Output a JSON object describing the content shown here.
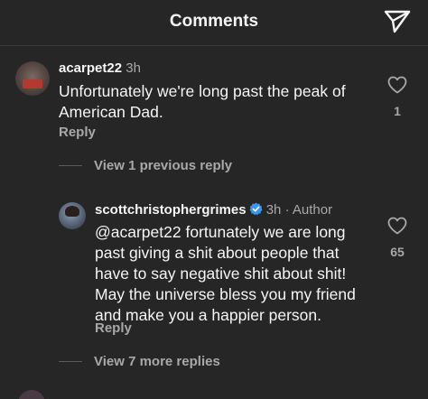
{
  "header": {
    "title": "Comments",
    "share_icon": "paper-plane-icon"
  },
  "comment": {
    "username": "acarpet22",
    "time": "3h",
    "text_line1": "Unfortunately we're long past the peak of",
    "text_line2": "American Dad.",
    "reply_label": "Reply",
    "like_count": "1",
    "view_previous": "View 1 previous reply"
  },
  "reply": {
    "username": "scottchristophergrimes",
    "time": "3h",
    "separator": "·",
    "author_label": "Author",
    "text_lines": [
      "@acarpet22  fortunately we are long",
      "past giving a shit about people that",
      "have to say negative shit about shit!",
      "May the universe bless you my friend",
      "and make you a happier person."
    ],
    "reply_label": "Reply",
    "like_count": "65",
    "view_more": "View 7 more replies"
  },
  "colors": {
    "background": "#262626",
    "text_primary": "#f5f5f5",
    "text_secondary": "#a8a8a8",
    "verified_blue": "#3897f0"
  }
}
